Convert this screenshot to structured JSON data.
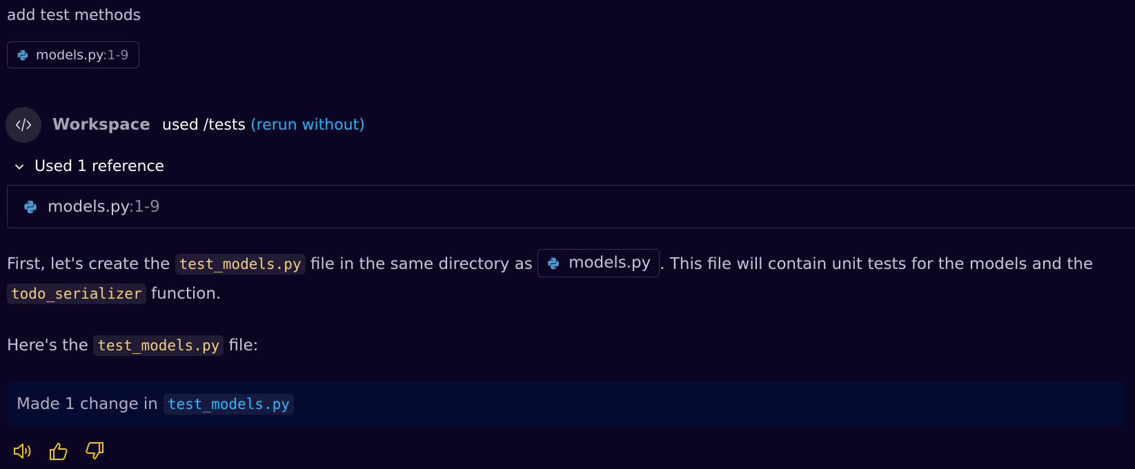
{
  "request": {
    "text": "add test methods",
    "attachment": {
      "filename": "models.py",
      "range": ":1-9"
    }
  },
  "agent": {
    "name": "Workspace",
    "used_command": "used /tests",
    "rerun_link": "(rerun without)"
  },
  "references": {
    "toggle_label": "Used 1 reference",
    "items": [
      {
        "filename": "models.py",
        "range": ":1-9"
      }
    ]
  },
  "response": {
    "para1": {
      "t1": "First, let's create the ",
      "code1": "test_models.py",
      "t2": " file in the same directory as ",
      "file_chip": "models.py",
      "t3": ". This file will contain unit tests for the models and the ",
      "code2": "todo_serializer",
      "t4": " function."
    },
    "para2": {
      "t1": "Here's the ",
      "code1": "test_models.py",
      "t2": " file:"
    },
    "change": {
      "text": "Made 1 change in",
      "file": "test_models.py"
    }
  },
  "actions": {
    "icons": [
      "speaker-icon",
      "thumbs-up-icon",
      "thumbs-down-icon"
    ],
    "color": "#f2c811"
  },
  "colors": {
    "background": "#0b0521",
    "link": "#22b5ff",
    "code_text": "#f4d27a"
  }
}
